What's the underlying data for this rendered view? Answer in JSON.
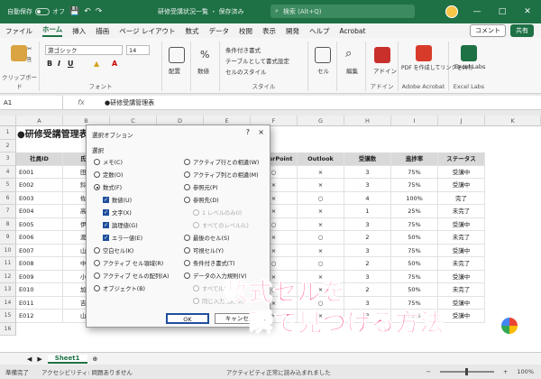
{
  "titlebar": {
    "autosave": "自動保存",
    "autosave_state": "オフ",
    "doc_title": "研修受講状況一覧 ・ 保存済み",
    "search_placeholder": "検索 (Alt+Q)"
  },
  "tabs": [
    "ファイル",
    "ホーム",
    "挿入",
    "描画",
    "ページ レイアウト",
    "数式",
    "データ",
    "校閲",
    "表示",
    "開発",
    "ヘルプ",
    "Acrobat"
  ],
  "tabs_right": {
    "comment": "コメント",
    "share": "共有"
  },
  "ribbon": {
    "clipboard": "クリップボード",
    "font_name": "游ゴシック",
    "font_size": "14",
    "font": "フォント",
    "alignment": "配置",
    "number": "数値",
    "cond_format": "条件付き書式",
    "table_format": "テーブルとして書式設定",
    "cell_style": "セルのスタイル",
    "style": "スタイル",
    "cells": "セル",
    "edit": "編集",
    "addin": "アドイン",
    "addin_group": "アドイン",
    "pdf": "PDF を作成してリンクを共有",
    "pdf_group": "Adobe Acrobat",
    "excel_labs": "Excel Labs",
    "excel_labs_group": "Excel Labs"
  },
  "formula": {
    "namebox": "A1",
    "content": "●研修受講管理表"
  },
  "columns": [
    "A",
    "B",
    "C",
    "D",
    "E",
    "F",
    "G",
    "H",
    "I",
    "J",
    "K"
  ],
  "sheet": {
    "title": "●研修受講管理表",
    "headers": [
      "社員ID",
      "氏名",
      "PowerPoint",
      "Outlook",
      "受講数",
      "進捗率",
      "ステータス"
    ],
    "rows": [
      {
        "id": "E001",
        "name": "田中",
        "ppt": "○",
        "outlook": "×",
        "count": "3",
        "rate": "75%",
        "status": "受講中"
      },
      {
        "id": "E002",
        "name": "鈴木",
        "ppt": "×",
        "outlook": "×",
        "count": "3",
        "rate": "75%",
        "status": "受講中"
      },
      {
        "id": "E003",
        "name": "佐藤",
        "ppt": "×",
        "outlook": "○",
        "count": "4",
        "rate": "100%",
        "status": "完了"
      },
      {
        "id": "E004",
        "name": "高橋",
        "ppt": "×",
        "outlook": "×",
        "count": "1",
        "rate": "25%",
        "status": "未完了"
      },
      {
        "id": "E005",
        "name": "伊藤",
        "ppt": "○",
        "outlook": "×",
        "count": "3",
        "rate": "75%",
        "status": "受講中"
      },
      {
        "id": "E006",
        "name": "渡辺",
        "ppt": "×",
        "outlook": "○",
        "count": "2",
        "rate": "50%",
        "status": "未完了"
      },
      {
        "id": "E007",
        "name": "山本",
        "ppt": "×",
        "outlook": "×",
        "count": "3",
        "rate": "75%",
        "status": "受講中"
      },
      {
        "id": "E008",
        "name": "中村",
        "ppt": "○",
        "outlook": "○",
        "count": "2",
        "rate": "50%",
        "status": "未完了"
      },
      {
        "id": "E009",
        "name": "小林",
        "ppt": "×",
        "outlook": "×",
        "count": "3",
        "rate": "75%",
        "status": "受講中"
      },
      {
        "id": "E010",
        "name": "加藤",
        "ppt": "○",
        "outlook": "×",
        "count": "2",
        "rate": "50%",
        "status": "未完了"
      },
      {
        "id": "E011",
        "name": "吉田",
        "ppt": "×",
        "outlook": "○",
        "count": "3",
        "rate": "75%",
        "status": "受講中"
      },
      {
        "id": "E012",
        "name": "山田",
        "ppt": "×",
        "outlook": "×",
        "count": "3",
        "rate": "75%",
        "status": "受講中"
      }
    ]
  },
  "dialog": {
    "title": "選択オプション",
    "help": "?",
    "close": "×",
    "section": "選択",
    "left": [
      {
        "label": "メモ(C)",
        "kind": "radio",
        "checked": false
      },
      {
        "label": "定数(O)",
        "kind": "radio",
        "checked": false
      },
      {
        "label": "数式(F)",
        "kind": "radio",
        "checked": true
      },
      {
        "label": "数値(U)",
        "kind": "check",
        "checked": true
      },
      {
        "label": "文字(X)",
        "kind": "check",
        "checked": true
      },
      {
        "label": "論理値(G)",
        "kind": "check",
        "checked": true
      },
      {
        "label": "エラー値(E)",
        "kind": "check",
        "checked": true
      },
      {
        "label": "空白セル(K)",
        "kind": "radio",
        "checked": false
      },
      {
        "label": "アクティブ セル領域(R)",
        "kind": "radio",
        "checked": false
      },
      {
        "label": "アクティブ セルの配列(A)",
        "kind": "radio",
        "checked": false
      },
      {
        "label": "オブジェクト(B)",
        "kind": "radio",
        "checked": false
      }
    ],
    "right": [
      {
        "label": "アクティブ行との相違(W)",
        "kind": "radio",
        "disabled": false
      },
      {
        "label": "アクティブ列との相違(M)",
        "kind": "radio",
        "disabled": false
      },
      {
        "label": "参照元(P)",
        "kind": "radio",
        "disabled": false
      },
      {
        "label": "参照先(D)",
        "kind": "radio",
        "disabled": false
      },
      {
        "label": "1 レベルのみ(I)",
        "kind": "radio",
        "disabled": true
      },
      {
        "label": "すべてのレベル(L)",
        "kind": "radio",
        "disabled": true
      },
      {
        "label": "最後のセル(S)",
        "kind": "radio",
        "disabled": false
      },
      {
        "label": "可視セル(Y)",
        "kind": "radio",
        "disabled": false
      },
      {
        "label": "条件付き書式(T)",
        "kind": "radio",
        "disabled": false
      },
      {
        "label": "データの入力規則(V)",
        "kind": "radio",
        "disabled": false
      },
      {
        "label": "すべて(L)",
        "kind": "radio",
        "disabled": true
      },
      {
        "label": "同じ入力規則(E)",
        "kind": "radio",
        "disabled": true
      }
    ],
    "ok": "OK",
    "cancel": "キャンセル"
  },
  "overlay": {
    "line1": "数式セルを",
    "line2": "瞬で見つける方法"
  },
  "sheettab": "Sheet1",
  "status": {
    "ready": "準備完了",
    "accessibility": "アクセシビリティ: 問題ありません",
    "zoom": "100%",
    "autosave_note": "アクティビティ正常に読み込まれました"
  }
}
